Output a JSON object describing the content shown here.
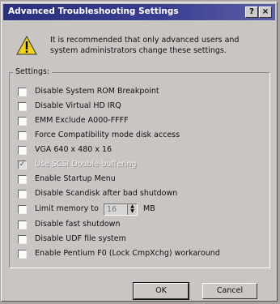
{
  "window": {
    "title": "Advanced Troubleshooting Settings",
    "help_label": "?",
    "close_label": "×"
  },
  "message": "It is recommended that only advanced users and system administrators change these settings.",
  "group_label": "Settings:",
  "options": [
    {
      "label": "Disable System ROM Breakpoint",
      "checked": false,
      "enabled": true
    },
    {
      "label": "Disable Virtual HD IRQ",
      "checked": false,
      "enabled": true
    },
    {
      "label": "EMM Exclude A000-FFFF",
      "checked": false,
      "enabled": true
    },
    {
      "label": "Force Compatibility mode disk access",
      "checked": false,
      "enabled": true
    },
    {
      "label": "VGA 640 x 480 x 16",
      "checked": false,
      "enabled": true
    },
    {
      "label": "Use SCSI Double-buffering",
      "checked": true,
      "enabled": false
    },
    {
      "label": "Enable Startup Menu",
      "checked": false,
      "enabled": true
    },
    {
      "label": "Disable Scandisk after bad shutdown",
      "checked": false,
      "enabled": true
    },
    {
      "label": "Limit memory to",
      "checked": false,
      "enabled": true
    },
    {
      "label": "Disable fast shutdown",
      "checked": false,
      "enabled": true
    },
    {
      "label": "Disable UDF file system",
      "checked": false,
      "enabled": true
    },
    {
      "label": "Enable Pentium F0 (Lock CmpXchg) workaround",
      "checked": false,
      "enabled": true
    }
  ],
  "memory_limit": {
    "value": "16",
    "unit": "MB"
  },
  "buttons": {
    "ok": "OK",
    "cancel": "Cancel"
  },
  "icons": {
    "warning": "warning-triangle-icon"
  },
  "colors": {
    "titlebar": "#2a2f7e",
    "dialog_bg": "#c9c5c3"
  }
}
